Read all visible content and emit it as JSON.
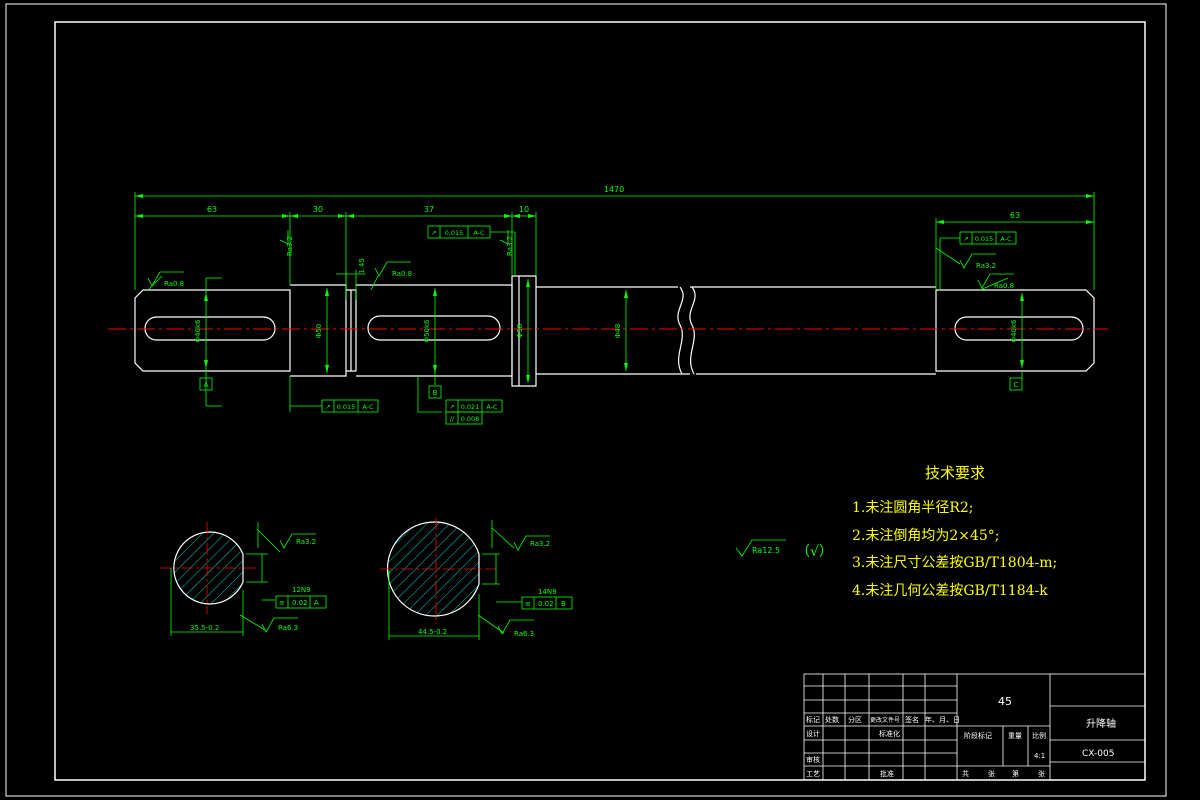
{
  "dimensions": {
    "total_length": "1470",
    "left_journal": "63",
    "seg_30": "30",
    "seg_37": "37",
    "seg_10": "10",
    "right_journal": "63",
    "dia_1": "Φ40k6",
    "dia_2": "Φ50",
    "dia_3": "Φ50k6",
    "dia_4": "Φ58",
    "dia_5": "Φ48",
    "dia_6": "Φ40k6",
    "groove": "1.45"
  },
  "roughness": {
    "r1": "Ra0.8",
    "r2": "Ra3.2",
    "r3": "Ra0.8",
    "r4": "Ra3.2",
    "r5": "Ra3.2",
    "r6": "Ra0.8",
    "sec1_top": "Ra3.2",
    "sec1_bottom": "Ra6.3",
    "sec2_top": "Ra3.2",
    "sec2_bottom": "Ra6.3",
    "general": "Ra12.5",
    "general_bracket": "（√）"
  },
  "tolerances": {
    "top_center": [
      "↗",
      "0.015",
      "A-C"
    ],
    "top_right": [
      "↗",
      "0.015",
      "A-C"
    ],
    "bottom_left": [
      "↗",
      "0.015",
      "A-C"
    ],
    "bottom_mid_1": [
      "↗",
      "0.021",
      "A-C"
    ],
    "bottom_mid_2": [
      "//",
      "0.008"
    ]
  },
  "datums": {
    "a": "A",
    "b": "B",
    "c": "C"
  },
  "sections": {
    "s1_width": "12N9",
    "s1_tol": [
      "≡",
      "0.02",
      "A"
    ],
    "s1_depth": "35.5-0.2",
    "s2_width": "14N9",
    "s2_tol": [
      "≡",
      "0.02",
      "B"
    ],
    "s2_depth": "44.5-0.2"
  },
  "notes": {
    "title": "技术要求",
    "items": [
      "1.未注圆角半径R2;",
      "2.未注倒角均为2×45°;",
      "3.未注尺寸公差按GB/T1804-m;",
      "4.未注几何公差按GB/T1184-k"
    ]
  },
  "title_block": {
    "material": "45",
    "part_name": "升降轴",
    "drawing_no": "CX-005",
    "header_cells": [
      "标记",
      "处数",
      "分区",
      "更改文件号",
      "签名",
      "年、月、日"
    ],
    "design": "设计",
    "standardize": "标准化",
    "check": "审核",
    "process": "工艺",
    "approve": "批准",
    "stage_mark": "阶段标记",
    "weight": "重量",
    "scale_label": "比例",
    "scale": "4:1",
    "sheets_total": "共",
    "sheet_label": "张",
    "sheet_no_label": "第",
    "sheet_label2": "张"
  },
  "colors": {
    "outline": "#ffffff",
    "dimension": "#00ff00",
    "centerline": "#ff0000",
    "hatch": "#00ffff",
    "background": "#000000"
  }
}
